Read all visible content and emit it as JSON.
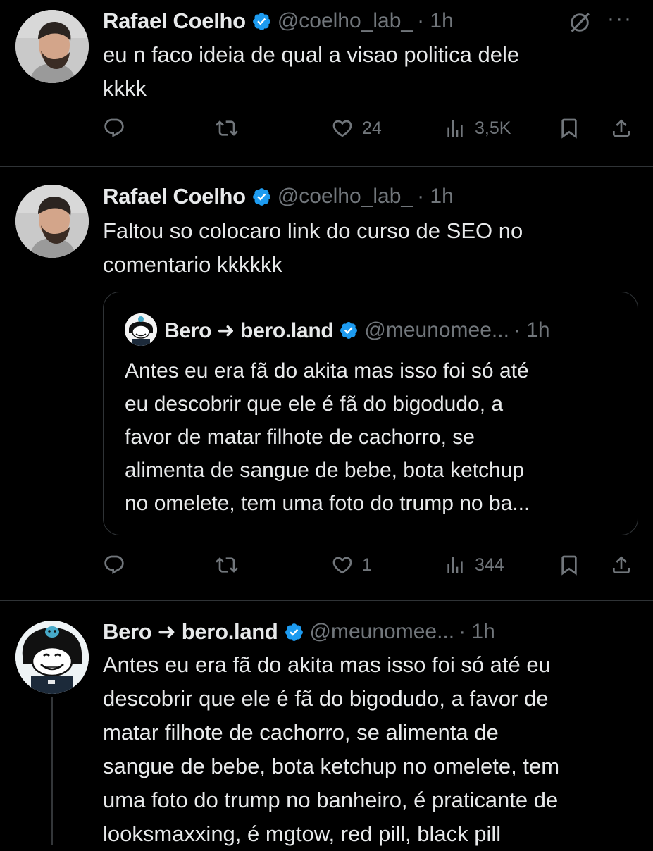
{
  "tweets": [
    {
      "author": "Rafael Coelho",
      "handle": "@coelho_lab_",
      "time": "· 1h",
      "text_lines": [
        "eu n faco ideia de qual a visao politica dele",
        "kkkk"
      ],
      "replies": "",
      "retweets": "",
      "likes": "24",
      "views": "3,5K"
    },
    {
      "author": "Rafael Coelho",
      "handle": "@coelho_lab_",
      "time": "· 1h",
      "text_lines": [
        "Faltou so colocaro link do curso de SEO no",
        "comentario kkkkkk"
      ],
      "quote": {
        "author": "Bero ➜ bero.land",
        "handle": "@meunomee...",
        "time": "· 1h",
        "text_lines": [
          "Antes eu era fã do akita mas isso foi só até",
          "eu descobrir que ele é fã do bigodudo, a",
          "favor de matar filhote de cachorro, se",
          "alimenta de sangue de bebe, bota ketchup",
          "no omelete, tem uma foto do trump no ba..."
        ]
      },
      "likes": "1",
      "views": "344"
    },
    {
      "author": "Bero ➜ bero.land",
      "handle": "@meunomee...",
      "time": "· 1h",
      "text_lines": [
        "Antes eu era fã do akita mas isso foi só até eu",
        "descobrir que ele é fã do bigodudo, a favor de",
        "matar filhote de cachorro, se alimenta de",
        "sangue de bebe, bota ketchup no omelete, tem",
        "uma foto do trump no banheiro, é praticante de",
        "looksmaxxing, é mgtow, red pill, black pill"
      ]
    }
  ],
  "icons": {
    "reply": "reply-icon",
    "retweet": "retweet-icon",
    "like": "heart-icon",
    "views": "views-icon",
    "bookmark": "bookmark-icon",
    "share": "share-icon",
    "more": "more-icon",
    "grok": "grok-icon",
    "verified": "verified-badge-icon"
  },
  "colors": {
    "background": "#000000",
    "text": "#e7e9ea",
    "muted": "#71767b",
    "verified": "#1d9bf0",
    "divider": "#2f3336"
  }
}
